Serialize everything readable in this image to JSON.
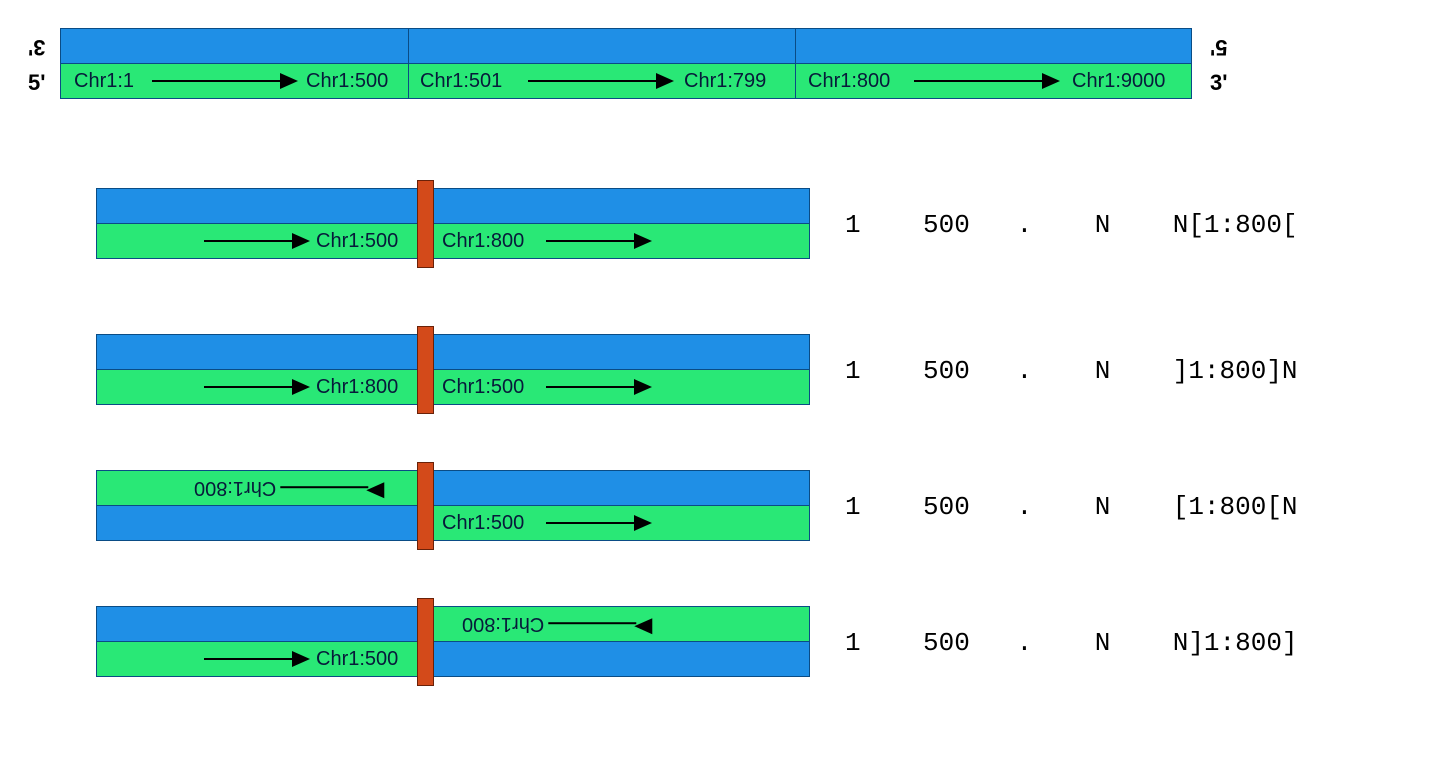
{
  "ends": {
    "topLeft3": "3'",
    "botLeft5": "5'",
    "topRight5": "5'",
    "botRight3": "3'"
  },
  "ref": {
    "seg1": {
      "start": "Chr1:1",
      "end": "Chr1:500"
    },
    "seg2": {
      "start": "Chr1:501",
      "end": "Chr1:799"
    },
    "seg3": {
      "start": "Chr1:800",
      "end": "Chr1:9000"
    }
  },
  "rows": [
    {
      "left": "Chr1:500",
      "right": "Chr1:800",
      "leftFlip": false,
      "rightFlip": false,
      "leftTop": false,
      "rightTop": false,
      "vcf": {
        "chrom": "1",
        "pos": "500",
        "id": ".",
        "ref": "N",
        "alt": "N[1:800["
      }
    },
    {
      "left": "Chr1:800",
      "right": "Chr1:500",
      "leftFlip": false,
      "rightFlip": false,
      "leftTop": false,
      "rightTop": false,
      "vcf": {
        "chrom": "1",
        "pos": "500",
        "id": ".",
        "ref": "N",
        "alt": "]1:800]N"
      }
    },
    {
      "left": "Chr1:800",
      "right": "Chr1:500",
      "leftFlip": true,
      "rightFlip": false,
      "leftTop": true,
      "rightTop": false,
      "vcf": {
        "chrom": "1",
        "pos": "500",
        "id": ".",
        "ref": "N",
        "alt": "[1:800[N"
      }
    },
    {
      "left": "Chr1:500",
      "right": "Chr1:800",
      "leftFlip": false,
      "rightFlip": true,
      "leftTop": false,
      "rightTop": true,
      "vcf": {
        "chrom": "1",
        "pos": "500",
        "id": ".",
        "ref": "N",
        "alt": "N]1:800]"
      }
    }
  ]
}
